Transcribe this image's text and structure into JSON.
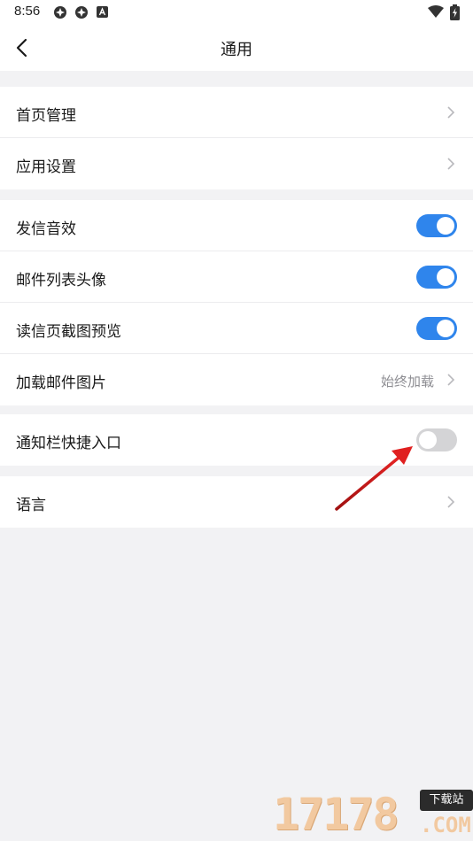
{
  "status_bar": {
    "time": "8:56"
  },
  "header": {
    "title": "通用",
    "back_icon": "chevron-left-icon"
  },
  "groups": [
    {
      "rows": [
        {
          "label": "首页管理",
          "control": "chevron"
        },
        {
          "label": "应用设置",
          "control": "chevron"
        }
      ]
    },
    {
      "rows": [
        {
          "label": "发信音效",
          "control": "toggle",
          "on": true
        },
        {
          "label": "邮件列表头像",
          "control": "toggle",
          "on": true
        },
        {
          "label": "读信页截图预览",
          "control": "toggle",
          "on": true
        },
        {
          "label": "加载邮件图片",
          "control": "chevron",
          "value": "始终加载"
        }
      ]
    },
    {
      "rows": [
        {
          "label": "通知栏快捷入口",
          "control": "toggle",
          "on": false
        }
      ]
    },
    {
      "rows": [
        {
          "label": "语言",
          "control": "chevron"
        }
      ]
    }
  ],
  "colors": {
    "accent": "#2f85ec",
    "toggle_off": "#d4d4d6",
    "background": "#f2f2f4",
    "annotation_arrow": "#d91e1e"
  },
  "watermark": {
    "digits": "17178",
    "badge": "下载站",
    "suffix": ".COM"
  }
}
